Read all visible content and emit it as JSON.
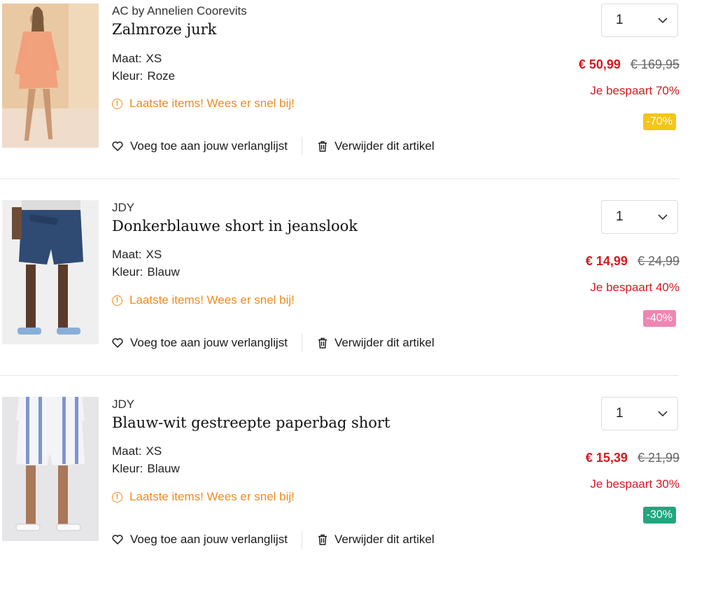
{
  "items": [
    {
      "brand": "AC by Annelien Coorevits",
      "title": "Zalmroze jurk",
      "size_label": "Maat:",
      "size_value": "XS",
      "color_label": "Kleur:",
      "color_value": "Roze",
      "warning": "Laatste items! Wees er snel bij!",
      "wishlist_label": "Voeg toe aan jouw verlanglijst",
      "remove_label": "Verwijder dit artikel",
      "quantity": "1",
      "price_now": "€ 50,99",
      "price_old": "€ 169,95",
      "savings": "Je bespaart 70%",
      "discount_badge": "-70%",
      "badge_color": "#f5c518"
    },
    {
      "brand": "JDY",
      "title": "Donkerblauwe short in jeanslook",
      "size_label": "Maat:",
      "size_value": "XS",
      "color_label": "Kleur:",
      "color_value": "Blauw",
      "warning": "Laatste items! Wees er snel bij!",
      "wishlist_label": "Voeg toe aan jouw verlanglijst",
      "remove_label": "Verwijder dit artikel",
      "quantity": "1",
      "price_now": "€ 14,99",
      "price_old": "€ 24,99",
      "savings": "Je bespaart 40%",
      "discount_badge": "-40%",
      "badge_color": "#ee86b4"
    },
    {
      "brand": "JDY",
      "title": "Blauw-wit gestreepte paperbag short",
      "size_label": "Maat:",
      "size_value": "XS",
      "color_label": "Kleur:",
      "color_value": "Blauw",
      "warning": "Laatste items! Wees er snel bij!",
      "wishlist_label": "Voeg toe aan jouw verlanglijst",
      "remove_label": "Verwijder dit artikel",
      "quantity": "1",
      "price_now": "€ 15,39",
      "price_old": "€ 21,99",
      "savings": "Je bespaart 30%",
      "discount_badge": "-30%",
      "badge_color": "#1fa77e"
    }
  ],
  "colors": {
    "price_red": "#d6181f",
    "warning_orange": "#ef8b1e",
    "separator": "#e6e6e6"
  },
  "icons": {
    "warning": "info-circle-icon",
    "wishlist": "heart-icon",
    "remove": "trash-icon",
    "dropdown": "chevron-down-icon"
  }
}
